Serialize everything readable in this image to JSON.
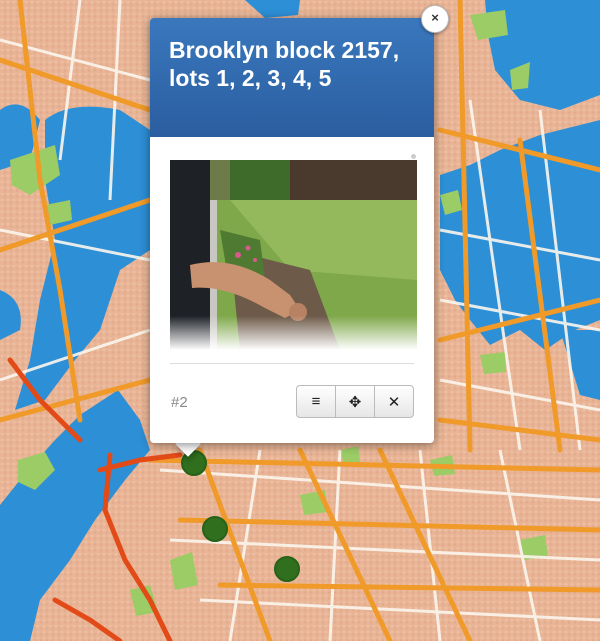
{
  "popup": {
    "title": "Brooklyn block 2157, lots 1, 2, 3, 4, 5",
    "close_icon": "×",
    "item_number": "#2",
    "buttons": [
      {
        "name": "list-icon",
        "glyph": "≡"
      },
      {
        "name": "move-icon",
        "glyph": "✥"
      },
      {
        "name": "remove-icon",
        "glyph": "✕"
      }
    ]
  },
  "markers": [
    {
      "name": "site-marker-1"
    },
    {
      "name": "site-marker-2"
    },
    {
      "name": "site-marker-3"
    }
  ],
  "colors": {
    "land": "#e9b89a",
    "water": "#2d8fd6",
    "road_major": "#f09a2a",
    "road_minor": "#fbf6ee",
    "park": "#9bcc65",
    "header": "#2f68ad",
    "marker": "#2f6f1e"
  }
}
